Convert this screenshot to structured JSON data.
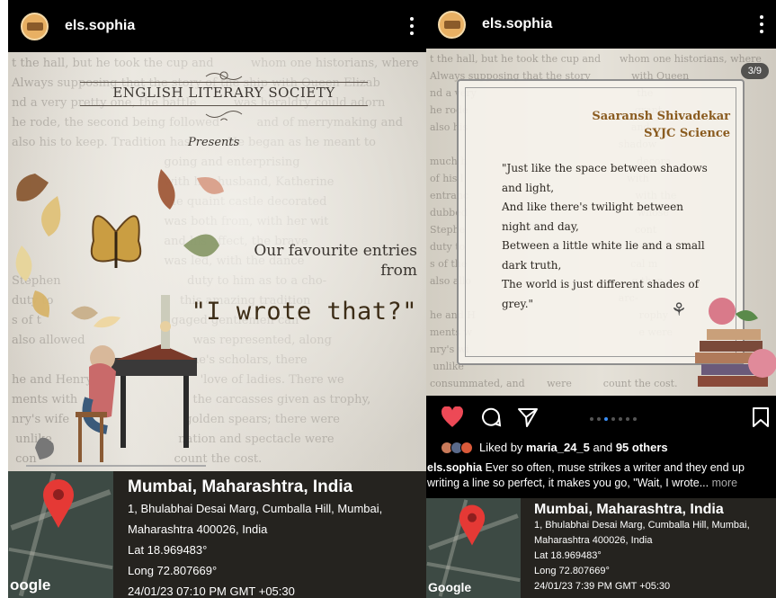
{
  "left": {
    "username": "els.sophia",
    "society": "ENGLISH LITERARY SOCIETY",
    "presents": "Presents",
    "fav_line1": "Our favourite entries",
    "fav_line2": "from",
    "wrote_title": "\"I wrote that?\"",
    "location": {
      "title": "Mumbai, Maharashtra, India",
      "address1": "1, Bhulabhai Desai Marg, Cumballa Hill, Mumbai,",
      "address2": "Maharashtra 400026, India",
      "lat": "Lat 18.969483°",
      "long": "Long 72.807669°",
      "timestamp": "24/01/23 07:10 PM GMT +05:30",
      "map_label": "oogle"
    }
  },
  "right": {
    "username": "els.sophia",
    "counter": "3/9",
    "author_name": "Saaransh Shivadekar",
    "author_class": "SYJC Science",
    "quote_lines": [
      "\"Just like the space between shadows",
      "and light,",
      "And like there's twilight between",
      "night and day,",
      "Between a little white lie and a small",
      "dark truth,",
      " The world is just different shades of",
      "grey.\""
    ],
    "likes": {
      "prefix": "Liked by ",
      "user": "maria_24_5",
      "mid": " and ",
      "count": "95 others"
    },
    "caption": {
      "user": "els.sophia",
      "text": " Ever so often, muse strikes a writer and they end up writing a line so perfect, it makes you go, \"Wait, I wrote...",
      "more": " more"
    },
    "location": {
      "title": "Mumbai, Maharashtra, India",
      "address1": "1, Bhulabhai Desai Marg, Cumballa Hill, Mumbai,",
      "address2": "Maharashtra 400026, India",
      "lat": "Lat 18.969483°",
      "long": "Long 72.807669°",
      "timestamp": "24/01/23 7:39 PM GMT +05:30",
      "map_label": "Google"
    },
    "carousel": {
      "active_index": 2,
      "total_dots": 7
    }
  },
  "icons": {
    "heart": "heart-icon",
    "comment": "comment-icon",
    "share": "send-icon",
    "save": "bookmark-icon",
    "more": "more-vertical-icon",
    "pin": "map-pin-icon"
  },
  "colors": {
    "like_red": "#ed4956",
    "pin_red": "#e53935",
    "author_brown": "#8a5b1f",
    "carousel_active": "#3a8ef6"
  }
}
